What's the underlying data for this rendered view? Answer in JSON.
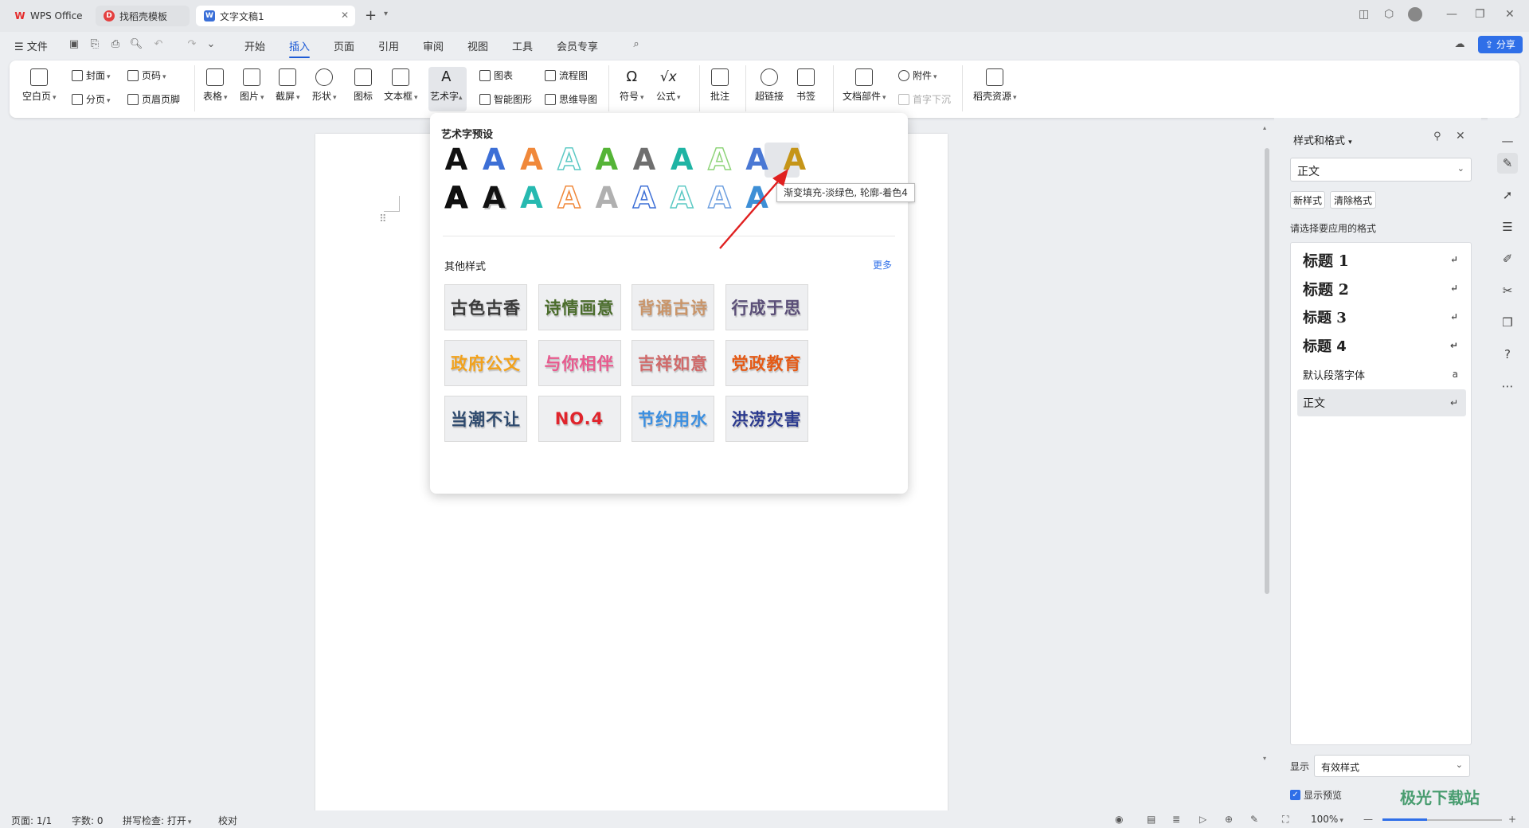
{
  "tabs": [
    {
      "label": "WPS Office",
      "icon": "wps-logo-icon"
    },
    {
      "label": "找稻壳模板",
      "icon": "docer-icon"
    },
    {
      "label": "文字文稿1",
      "icon": "word-doc-icon"
    }
  ],
  "menu": {
    "file": "文件",
    "items": [
      "开始",
      "插入",
      "页面",
      "引用",
      "审阅",
      "视图",
      "工具",
      "会员专享"
    ],
    "active": "插入",
    "share": "分享"
  },
  "ribbon": {
    "blank_page": "空白页",
    "cover": "封面",
    "page_break": "分页",
    "page_number": "页码",
    "header_footer": "页眉页脚",
    "table": "表格",
    "picture": "图片",
    "screenshot": "截屏",
    "shape": "形状",
    "icon": "图标",
    "textbox": "文本框",
    "wordart": "艺术字",
    "chart": "图表",
    "smart_graphic": "智能图形",
    "flowchart": "流程图",
    "mindmap": "思维导图",
    "symbol": "符号",
    "formula": "公式",
    "comment": "批注",
    "hyperlink": "超链接",
    "bookmark": "书签",
    "doc_parts": "文档部件",
    "attachment": "附件",
    "drop_cap": "首字下沉",
    "docer_resources": "稻壳资源"
  },
  "wordart_panel": {
    "preset_title": "艺术字预设",
    "tooltip": "渐变填充-淡绿色, 轮廓-着色4",
    "other_title": "其他样式",
    "more": "更多",
    "glyph": "A",
    "presets_row1": [
      "#111111",
      "#3d6fd6",
      "#f0883a",
      "#5cc9c4",
      "#55b437",
      "#6f6f6f",
      "#1fb4a4",
      "#8fd47a",
      "#4a78d4",
      "#c59518"
    ],
    "presets_row2": [
      "#111111",
      "#111111",
      "#26b9b0",
      "#f0883a",
      "#b0b0b0",
      "#3d6fd6",
      "#5cc9c4",
      "#6fa0e0",
      "#3d8fd6"
    ],
    "cards": [
      {
        "text": "古色古香",
        "color": "#3a3a3a"
      },
      {
        "text": "诗情画意",
        "color": "#4b6d2c"
      },
      {
        "text": "背诵古诗",
        "color": "#c9956a"
      },
      {
        "text": "行成于思",
        "color": "#5b4f78"
      },
      {
        "text": "政府公文",
        "color": "#f2a21c"
      },
      {
        "text": "与你相伴",
        "color": "#e85a8e"
      },
      {
        "text": "吉祥如意",
        "color": "#d06a6a"
      },
      {
        "text": "党政教育",
        "color": "#e45a16"
      },
      {
        "text": "当潮不让",
        "color": "#2e4a6e"
      },
      {
        "text": "NO.4",
        "color": "#e0242c"
      },
      {
        "text": "节约用水",
        "color": "#3c8fe0"
      },
      {
        "text": "洪涝灾害",
        "color": "#2b3a8f"
      }
    ]
  },
  "styles_panel": {
    "title": "样式和格式",
    "current_style": "正文",
    "new_style": "新样式",
    "clear_format": "清除格式",
    "choose_label": "请选择要应用的格式",
    "items": [
      {
        "label": "标题  1",
        "mark": "↵"
      },
      {
        "label": "标题  2",
        "mark": "↵"
      },
      {
        "label": "标题  3",
        "mark": "↵"
      },
      {
        "label": "标题  4",
        "mark": "↵"
      },
      {
        "label": "默认段落字体",
        "mark": "a"
      },
      {
        "label": "正文",
        "mark": "↵"
      }
    ],
    "show_label": "显示",
    "show_value": "有效样式",
    "preview_label": "显示预览"
  },
  "status": {
    "page": "页面: 1/1",
    "words": "字数: 0",
    "spell": "拼写检查: 打开",
    "proof": "校对",
    "zoom": "100%"
  },
  "watermark": "极光下载站"
}
